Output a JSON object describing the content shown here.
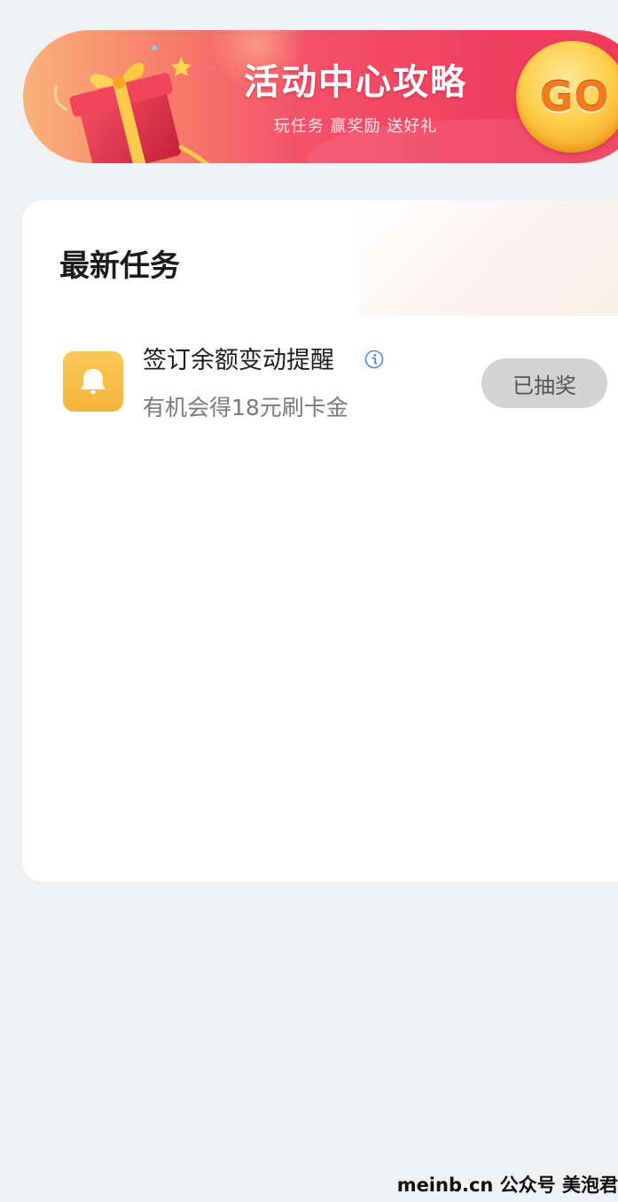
{
  "banner": {
    "title": "活动中心攻略",
    "subtitle": "玩任务 赢奖励 送好礼",
    "go_label": "GO"
  },
  "tasks_section": {
    "title": "最新任务",
    "tasks": [
      {
        "name": "签订余额变动提醒",
        "description": "有机会得18元刷卡金",
        "button_label": "已抽奖",
        "icon": "bell-icon"
      }
    ]
  },
  "watermark": "meinb.cn  公众号 美泡君",
  "colors": {
    "banner_start": "#f9b37a",
    "banner_end": "#ee3b5c",
    "go_gold": "#ffcf4a",
    "task_icon_bg": "#f4b43a",
    "button_disabled_bg": "#d3d3d3",
    "page_bg": "#f0f1f3"
  }
}
